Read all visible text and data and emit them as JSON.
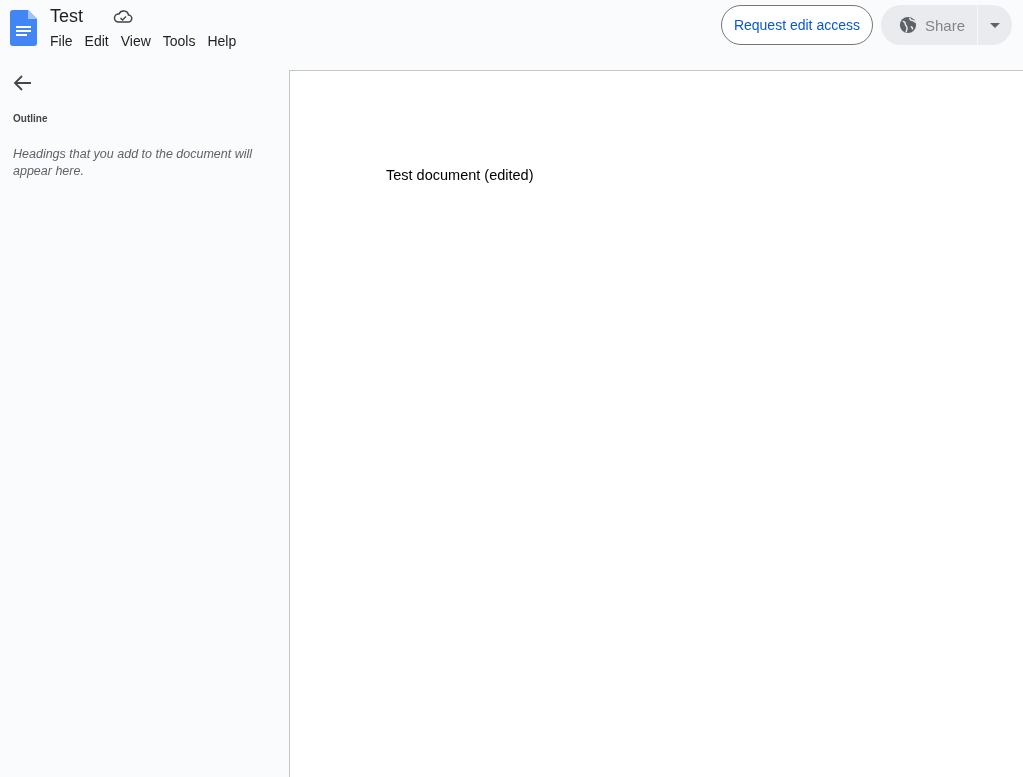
{
  "document": {
    "title": "Test"
  },
  "menu": [
    "File",
    "Edit",
    "View",
    "Tools",
    "Help"
  ],
  "request_button": {
    "label": "Request edit access"
  },
  "share_button": {
    "label": "Share",
    "disabled": true
  },
  "outline": {
    "heading": "Outline",
    "empty_message": "Headings that you add to the document will appear here."
  },
  "page": {
    "text": "Test document (edited)"
  }
}
